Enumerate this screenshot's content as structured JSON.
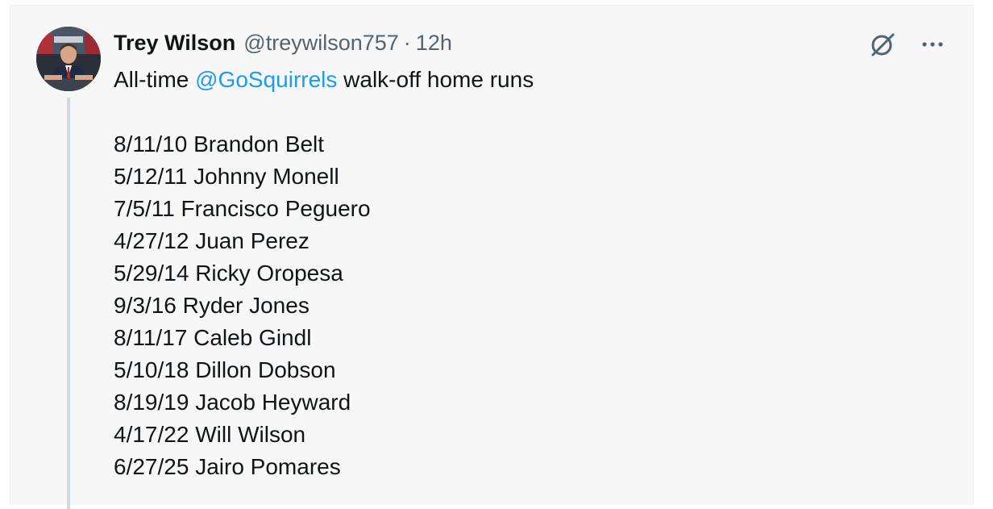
{
  "tweet": {
    "author_name": "Trey Wilson",
    "author_handle": "@treywilson757",
    "separator": "·",
    "time": "12h",
    "intro_prefix": "All-time ",
    "mention": "@GoSquirrels",
    "intro_suffix": " walk-off home runs",
    "items": [
      "8/11/10 Brandon Belt",
      "5/12/11 Johnny Monell",
      "7/5/11 Francisco Peguero",
      "4/27/12 Juan Perez",
      "5/29/14 Ricky Oropesa",
      "9/3/16 Ryder Jones",
      "8/11/17 Caleb Gindl",
      "5/10/18 Dillon Dobson",
      "8/19/19 Jacob Heyward",
      "4/17/22 Will Wilson",
      "6/27/25 Jairo Pomares"
    ]
  },
  "icons": {
    "grok": "grok-icon",
    "more": "more-icon"
  },
  "colors": {
    "text": "#0f1419",
    "secondary": "#536471",
    "link": "#1d9bf0",
    "thread_line": "#cfd9de",
    "background": "#f7f7f7"
  }
}
